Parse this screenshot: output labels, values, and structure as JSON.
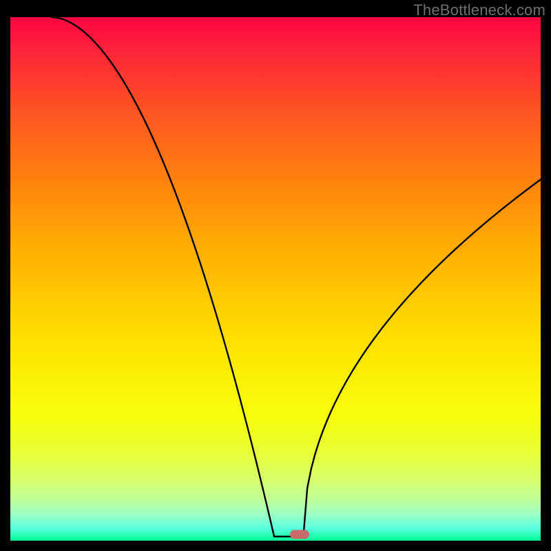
{
  "watermark": "TheBottleneck.com",
  "curve": {
    "left_start_x_frac": 0.078,
    "valley_x_frac": 0.525,
    "valley_flat_width_frac": 0.055,
    "right_end_y_frac": 0.31,
    "left_shape_exp": 1.85,
    "right_shape_exp": 2.05
  },
  "marker": {
    "x_frac": 0.545,
    "y_frac": 0.988
  },
  "chart_data": {
    "type": "line",
    "title": "",
    "xlabel": "",
    "ylabel": "",
    "xlim": [
      0,
      1
    ],
    "ylim": [
      0,
      1
    ],
    "series": [
      {
        "name": "bottleneck-curve",
        "x": [
          0.078,
          0.12,
          0.17,
          0.22,
          0.27,
          0.32,
          0.37,
          0.42,
          0.46,
          0.495,
          0.525,
          0.58,
          0.62,
          0.67,
          0.72,
          0.77,
          0.82,
          0.87,
          0.92,
          0.97,
          1.0
        ],
        "y": [
          1.0,
          0.85,
          0.7,
          0.56,
          0.43,
          0.31,
          0.21,
          0.12,
          0.06,
          0.015,
          0.0,
          0.0,
          0.015,
          0.06,
          0.14,
          0.24,
          0.35,
          0.46,
          0.56,
          0.65,
          0.69
        ]
      }
    ],
    "annotations": [
      {
        "type": "marker",
        "x": 0.545,
        "y": 0.012,
        "label": "optimal-point"
      }
    ],
    "background": "red-to-green vertical heat gradient"
  }
}
